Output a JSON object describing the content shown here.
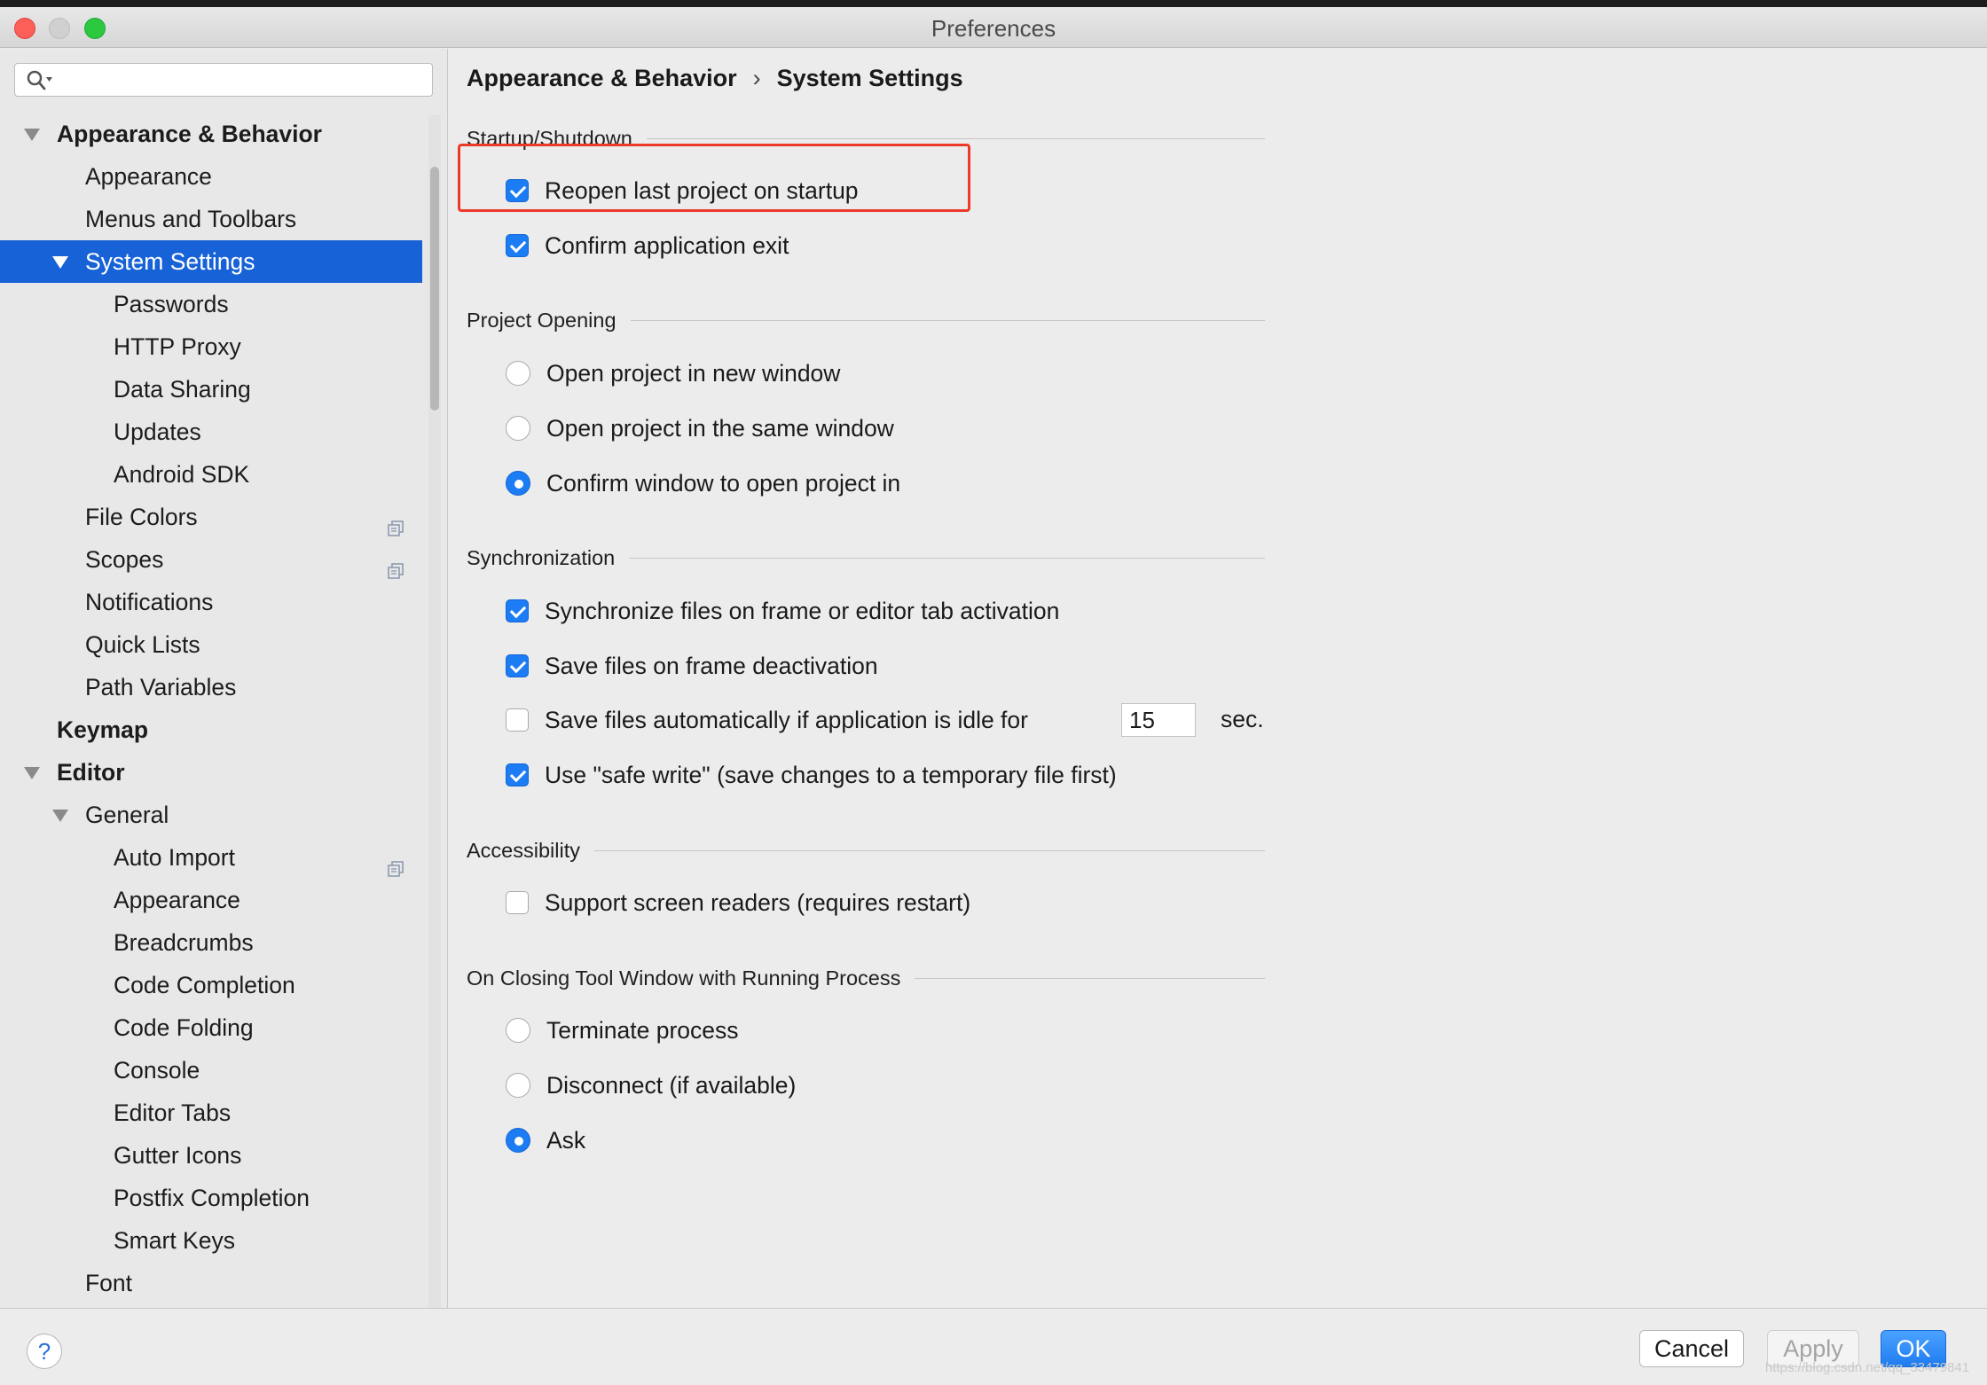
{
  "window": {
    "title": "Preferences"
  },
  "sidebar": {
    "search": {
      "value": "",
      "placeholder": ""
    },
    "items": [
      {
        "label": "Appearance & Behavior",
        "level": 0,
        "bold": true,
        "expanded": true,
        "selected": false,
        "badge": false
      },
      {
        "label": "Appearance",
        "level": 1,
        "bold": false,
        "expanded": false,
        "selected": false,
        "badge": false
      },
      {
        "label": "Menus and Toolbars",
        "level": 1,
        "bold": false,
        "expanded": false,
        "selected": false,
        "badge": false
      },
      {
        "label": "System Settings",
        "level": 1,
        "bold": false,
        "expanded": true,
        "selected": true,
        "badge": false
      },
      {
        "label": "Passwords",
        "level": 2,
        "bold": false,
        "expanded": false,
        "selected": false,
        "badge": false
      },
      {
        "label": "HTTP Proxy",
        "level": 2,
        "bold": false,
        "expanded": false,
        "selected": false,
        "badge": false
      },
      {
        "label": "Data Sharing",
        "level": 2,
        "bold": false,
        "expanded": false,
        "selected": false,
        "badge": false
      },
      {
        "label": "Updates",
        "level": 2,
        "bold": false,
        "expanded": false,
        "selected": false,
        "badge": false
      },
      {
        "label": "Android SDK",
        "level": 2,
        "bold": false,
        "expanded": false,
        "selected": false,
        "badge": false
      },
      {
        "label": "File Colors",
        "level": 1,
        "bold": false,
        "expanded": false,
        "selected": false,
        "badge": true
      },
      {
        "label": "Scopes",
        "level": 1,
        "bold": false,
        "expanded": false,
        "selected": false,
        "badge": true
      },
      {
        "label": "Notifications",
        "level": 1,
        "bold": false,
        "expanded": false,
        "selected": false,
        "badge": false
      },
      {
        "label": "Quick Lists",
        "level": 1,
        "bold": false,
        "expanded": false,
        "selected": false,
        "badge": false
      },
      {
        "label": "Path Variables",
        "level": 1,
        "bold": false,
        "expanded": false,
        "selected": false,
        "badge": false
      },
      {
        "label": "Keymap",
        "level": 0,
        "bold": true,
        "expanded": false,
        "selected": false,
        "badge": false
      },
      {
        "label": "Editor",
        "level": 0,
        "bold": true,
        "expanded": true,
        "selected": false,
        "badge": false
      },
      {
        "label": "General",
        "level": 1,
        "bold": false,
        "expanded": true,
        "selected": false,
        "badge": false
      },
      {
        "label": "Auto Import",
        "level": 2,
        "bold": false,
        "expanded": false,
        "selected": false,
        "badge": true
      },
      {
        "label": "Appearance",
        "level": 2,
        "bold": false,
        "expanded": false,
        "selected": false,
        "badge": false
      },
      {
        "label": "Breadcrumbs",
        "level": 2,
        "bold": false,
        "expanded": false,
        "selected": false,
        "badge": false
      },
      {
        "label": "Code Completion",
        "level": 2,
        "bold": false,
        "expanded": false,
        "selected": false,
        "badge": false
      },
      {
        "label": "Code Folding",
        "level": 2,
        "bold": false,
        "expanded": false,
        "selected": false,
        "badge": false
      },
      {
        "label": "Console",
        "level": 2,
        "bold": false,
        "expanded": false,
        "selected": false,
        "badge": false
      },
      {
        "label": "Editor Tabs",
        "level": 2,
        "bold": false,
        "expanded": false,
        "selected": false,
        "badge": false
      },
      {
        "label": "Gutter Icons",
        "level": 2,
        "bold": false,
        "expanded": false,
        "selected": false,
        "badge": false
      },
      {
        "label": "Postfix Completion",
        "level": 2,
        "bold": false,
        "expanded": false,
        "selected": false,
        "badge": false
      },
      {
        "label": "Smart Keys",
        "level": 2,
        "bold": false,
        "expanded": false,
        "selected": false,
        "badge": false
      },
      {
        "label": "Font",
        "level": 1,
        "bold": false,
        "expanded": false,
        "selected": false,
        "badge": false
      }
    ]
  },
  "main": {
    "breadcrumb": {
      "parent": "Appearance & Behavior",
      "separator": "›",
      "current": "System Settings"
    },
    "startup": {
      "title": "Startup/Shutdown",
      "reopen_label": "Reopen last project on startup",
      "reopen_checked": true,
      "confirm_exit_label": "Confirm application exit",
      "confirm_exit_checked": true
    },
    "project_opening": {
      "title": "Project Opening",
      "options": [
        {
          "label": "Open project in new window",
          "selected": false
        },
        {
          "label": "Open project in the same window",
          "selected": false
        },
        {
          "label": "Confirm window to open project in",
          "selected": true
        }
      ]
    },
    "synchronization": {
      "title": "Synchronization",
      "sync_files_label": "Synchronize files on frame or editor tab activation",
      "sync_files_checked": true,
      "save_deactivation_label": "Save files on frame deactivation",
      "save_deactivation_checked": true,
      "save_idle_label": "Save files automatically if application is idle for",
      "save_idle_checked": false,
      "idle_seconds": "15",
      "idle_unit": "sec.",
      "safe_write_label": "Use \"safe write\" (save changes to a temporary file first)",
      "safe_write_checked": true
    },
    "accessibility": {
      "title": "Accessibility",
      "screen_readers_label": "Support screen readers (requires restart)",
      "screen_readers_checked": false
    },
    "closing_tool_window": {
      "title": "On Closing Tool Window with Running Process",
      "options": [
        {
          "label": "Terminate process",
          "selected": false
        },
        {
          "label": "Disconnect (if available)",
          "selected": false
        },
        {
          "label": "Ask",
          "selected": true
        }
      ]
    }
  },
  "footer": {
    "help_label": "?",
    "cancel_label": "Cancel",
    "apply_label": "Apply",
    "ok_label": "OK",
    "watermark": "https://blog.csdn.net/qq_33479841"
  },
  "colors": {
    "accent": "#1c7cf4",
    "selection": "#1762d6",
    "highlight_annotation": "#ec3a2a"
  },
  "icons": {
    "search": "search-icon",
    "tree_expand": "chevron-down-icon",
    "project_level_badge": "copy-icon",
    "help": "help-icon"
  }
}
